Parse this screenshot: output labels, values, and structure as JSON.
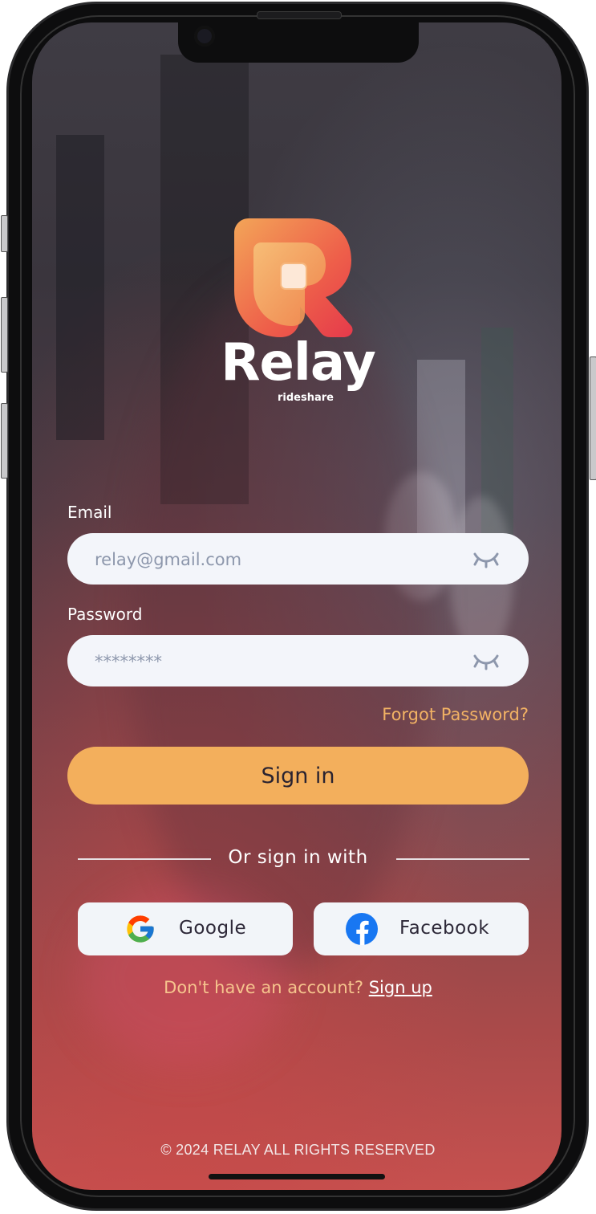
{
  "brand": {
    "name": "Relay",
    "tagline": "rideshare",
    "logo_colors": [
      "#f3a558",
      "#ee5f4a",
      "#e53a4b"
    ]
  },
  "form": {
    "email_label": "Email",
    "email_placeholder": "relay@gmail.com",
    "password_label": "Password",
    "password_placeholder": "********",
    "visibility_icon": "eye-closed-icon",
    "forgot_label": "Forgot Password?",
    "signin_label": "Sign in"
  },
  "social": {
    "divider_text": "Or sign in with",
    "google_label": "Google",
    "facebook_label": "Facebook"
  },
  "signup": {
    "prompt": "Don't have an account?",
    "link_label": "Sign up"
  },
  "footer": {
    "copyright": "© 2024 RELAY ALL RIGHTS RESERVED"
  },
  "colors": {
    "accent": "#f3af5c",
    "link": "#f2b264",
    "field_bg": "#f3f5fa"
  }
}
